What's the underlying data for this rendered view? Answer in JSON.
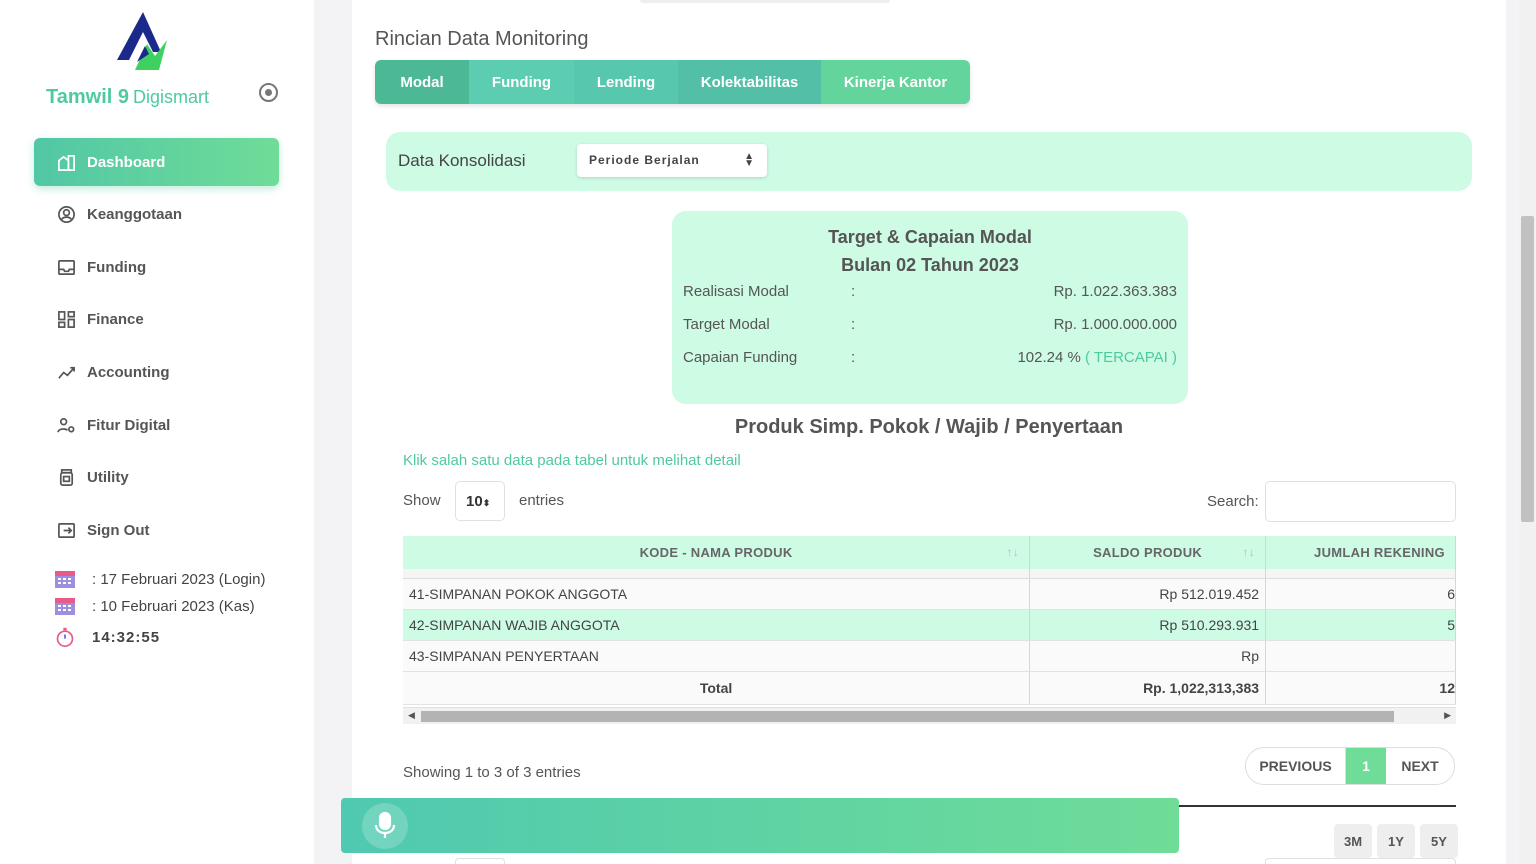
{
  "brand": {
    "name": "Tamwil 9",
    "sub": "Digismart"
  },
  "sidebar": {
    "items": [
      {
        "label": "Dashboard",
        "icon": "dashboard-icon"
      },
      {
        "label": "Keanggotaan",
        "icon": "user-circle-icon"
      },
      {
        "label": "Funding",
        "icon": "inbox-icon"
      },
      {
        "label": "Finance",
        "icon": "grid-icon"
      },
      {
        "label": "Accounting",
        "icon": "chart-line-icon"
      },
      {
        "label": "Fitur Digital",
        "icon": "user-gear-icon"
      },
      {
        "label": "Utility",
        "icon": "jar-icon"
      },
      {
        "label": "Sign Out",
        "icon": "sign-out-icon"
      }
    ],
    "info": {
      "login": ": 17 Februari 2023 (Login)",
      "kas": ": 10 Februari 2023 (Kas)",
      "time": "14:32:55"
    }
  },
  "main": {
    "section_title": "Rincian Data Monitoring",
    "tabs": [
      {
        "label": "Modal",
        "color": "#4db896"
      },
      {
        "label": "Funding",
        "color": "#5ccdb1"
      },
      {
        "label": "Lending",
        "color": "#57c7ae"
      },
      {
        "label": "Kolektabilitas",
        "color": "#52bfa6"
      },
      {
        "label": "Kinerja Kantor",
        "color": "#63d49c"
      }
    ],
    "konsolidasi": {
      "label": "Data Konsolidasi",
      "period": "Periode Berjalan"
    },
    "target": {
      "title": "Target & Capaian Modal",
      "subtitle": "Bulan 02 Tahun 2023",
      "rows": [
        {
          "key": "Realisasi Modal",
          "sep": ":",
          "value": "Rp. 1.022.363.383"
        },
        {
          "key": "Target Modal",
          "sep": ":",
          "value": "Rp. 1.000.000.000"
        },
        {
          "key": "Capaian Funding",
          "sep": ":",
          "value": "102.24 %",
          "status": "( TERCAPAI )"
        }
      ]
    },
    "product_title": "Produk Simp. Pokok / Wajib / Penyertaan",
    "hint": "Klik salah satu data pada tabel untuk melihat detail",
    "table_controls": {
      "show": "Show",
      "entries_value": "10",
      "entries": "entries",
      "search": "Search:"
    },
    "table": {
      "headers": [
        "KODE - NAMA PRODUK",
        "SALDO PRODUK",
        "JUMLAH REKENING"
      ],
      "rows": [
        [
          "41-SIMPANAN POKOK ANGGOTA",
          "Rp 512.019.452",
          "6"
        ],
        [
          "42-SIMPANAN WAJIB ANGGOTA",
          "Rp 510.293.931",
          "5"
        ],
        [
          "43-SIMPANAN PENYERTAAN",
          "Rp",
          ""
        ]
      ],
      "total": [
        "Total",
        "Rp. 1,022,313,383",
        "12"
      ]
    },
    "showing": "Showing 1 to 3 of 3 entries",
    "pager": {
      "prev": "PREVIOUS",
      "current": "1",
      "next": "NEXT"
    },
    "ranges": [
      "3M",
      "1Y",
      "5Y"
    ]
  },
  "colors": {
    "accent": "#4fc9a0",
    "light_green": "#cdfbe4"
  }
}
